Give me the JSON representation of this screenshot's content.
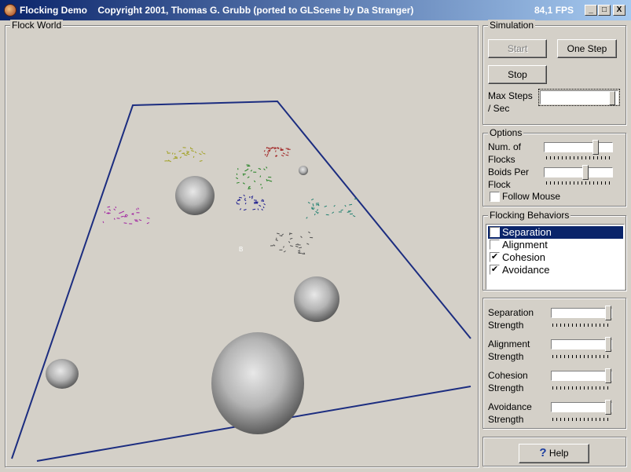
{
  "window": {
    "title": "Flocking Demo    Copyright 2001, Thomas G. Grubb (ported to GLScene by Da Stranger)",
    "fps": "84,1 FPS",
    "controls": {
      "minimize": "_",
      "maximize": "□",
      "close": "X"
    }
  },
  "world": {
    "label": "Flock World",
    "boid_marker": "B",
    "flock_colors": [
      "#a0a020",
      "#a02020",
      "#208020",
      "#202090",
      "#a020a0",
      "#208070",
      "#505050"
    ]
  },
  "simulation": {
    "label": "Simulation",
    "start": "Start",
    "one_step": "One Step",
    "stop": "Stop",
    "max_steps_line1": "Max Steps",
    "max_steps_line2": "/ Sec",
    "max_steps_value": 0.97
  },
  "options": {
    "label": "Options",
    "num_flocks_line1": "Num. of",
    "num_flocks_line2": "Flocks",
    "num_flocks_value": 0.78,
    "boids_per_flock_line1": "Boids Per",
    "boids_per_flock_line2": "Flock",
    "boids_per_flock_value": 0.62,
    "follow_mouse": "Follow Mouse",
    "follow_mouse_checked": false
  },
  "behaviors": {
    "label": "Flocking Behaviors",
    "items": [
      {
        "label": "Separation",
        "checked": false,
        "selected": true
      },
      {
        "label": "Alignment",
        "checked": false,
        "selected": false
      },
      {
        "label": "Cohesion",
        "checked": true,
        "selected": false
      },
      {
        "label": "Avoidance",
        "checked": true,
        "selected": false
      }
    ]
  },
  "strengths": [
    {
      "line1": "Separation",
      "line2": "Strength",
      "value": 1.0
    },
    {
      "line1": "Alignment",
      "line2": "Strength",
      "value": 1.0
    },
    {
      "line1": "Cohesion",
      "line2": "Strength",
      "value": 1.0
    },
    {
      "line1": "Avoidance",
      "line2": "Strength",
      "value": 1.0
    }
  ],
  "help": {
    "icon": "?",
    "label": "Help"
  }
}
